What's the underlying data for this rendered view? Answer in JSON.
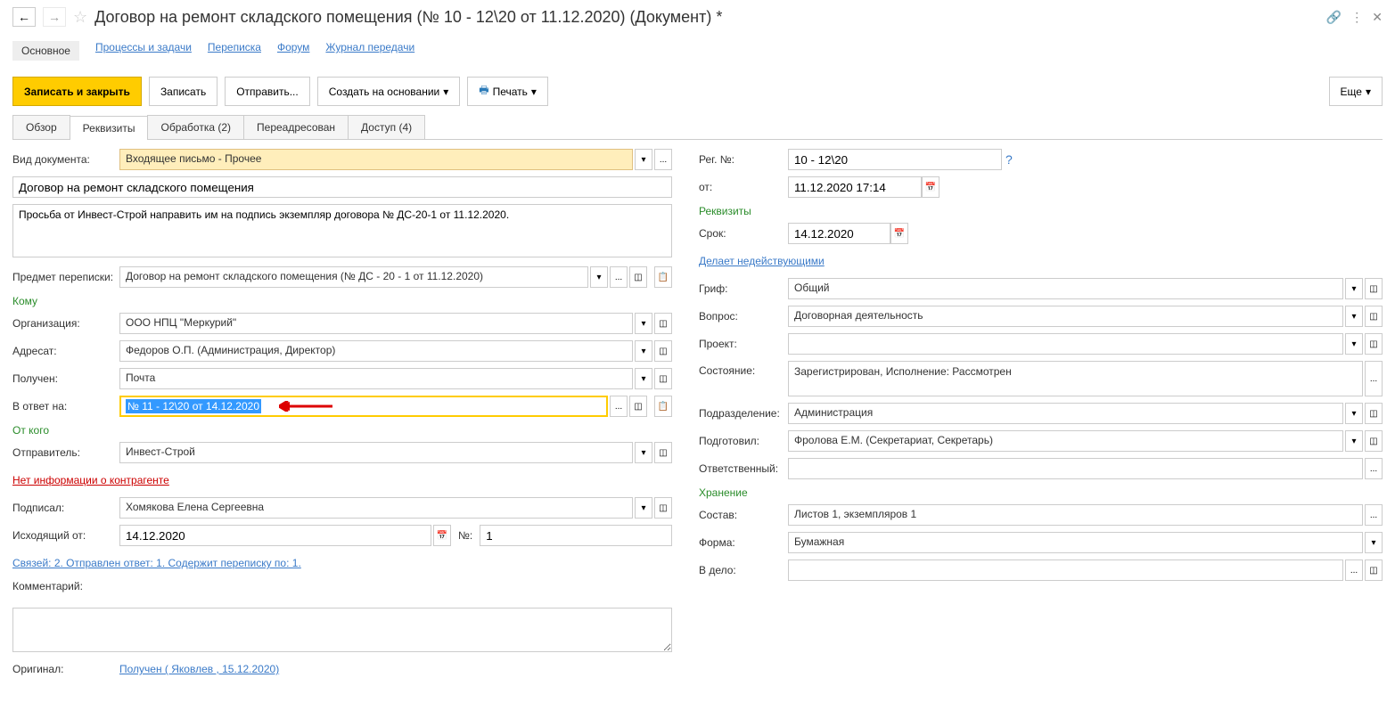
{
  "header": {
    "title": "Договор на ремонт складского помещения (№ 10 - 12\\20 от 11.12.2020) (Документ) *"
  },
  "nav": {
    "main": "Основное",
    "processes": "Процессы и задачи",
    "correspondence": "Переписка",
    "forum": "Форум",
    "transfer": "Журнал передачи"
  },
  "toolbar": {
    "save_close": "Записать и закрыть",
    "save": "Записать",
    "send": "Отправить...",
    "create_based": "Создать на основании",
    "print": "Печать",
    "more": "Еще"
  },
  "tabs": {
    "overview": "Обзор",
    "requisites": "Реквизиты",
    "processing": "Обработка (2)",
    "forwarded": "Переадресован",
    "access": "Доступ (4)"
  },
  "left": {
    "doc_type_label": "Вид документа:",
    "doc_type": "Входящее письмо - Прочее",
    "doc_title": "Договор на ремонт складского помещения",
    "description": "Просьба от Инвест-Строй направить им на подпись экземпляр договора № ДС-20-1 от 11.12.2020.",
    "subject_label": "Предмет переписки:",
    "subject": "Договор на ремонт складского помещения (№ ДС - 20 - 1 от 11.12.2020)",
    "komu_title": "Кому",
    "org_label": "Организация:",
    "org": "ООО НПЦ \"Меркурий\"",
    "addressee_label": "Адресат:",
    "addressee": "Федоров О.П. (Администрация, Директор)",
    "received_label": "Получен:",
    "received": "Почта",
    "reply_to_label": "В ответ на:",
    "reply_to": "№ 11 - 12\\20 от 14.12.2020",
    "otkogo_title": "От кого",
    "sender_label": "Отправитель:",
    "sender": "Инвест-Строй",
    "no_info_link": "Нет информации о контрагенте",
    "signed_label": "Подписал:",
    "signed": "Хомякова Елена Сергеевна",
    "outgoing_from_label": "Исходящий от:",
    "outgoing_from": "14.12.2020",
    "num_label": "№:",
    "num": "1",
    "links_info": "Связей: 2. Отправлен ответ: 1. Содержит переписку по: 1.",
    "comment_label": "Комментарий:",
    "original_label": "Оригинал:",
    "original_link": "Получен ( Яковлев , 15.12.2020)"
  },
  "right": {
    "reg_no_label": "Рег. №:",
    "reg_no": "10 - 12\\20",
    "from_label": "от:",
    "from": "11.12.2020 17:14",
    "req_title": "Реквизиты",
    "due_label": "Срок:",
    "due": "14.12.2020",
    "invalidates_link": "Делает недействующими",
    "grif_label": "Гриф:",
    "grif": "Общий",
    "question_label": "Вопрос:",
    "question": "Договорная деятельность",
    "project_label": "Проект:",
    "state_label": "Состояние:",
    "state": "Зарегистрирован, Исполнение: Рассмотрен",
    "dept_label": "Подразделение:",
    "dept": "Администрация",
    "prepared_label": "Подготовил:",
    "prepared": "Фролова Е.М. (Секретариат, Секретарь)",
    "responsible_label": "Ответственный:",
    "storage_title": "Хранение",
    "composition_label": "Состав:",
    "composition": "Листов 1, экземпляров 1",
    "form_label": "Форма:",
    "form": "Бумажная",
    "to_case_label": "В дело:"
  }
}
